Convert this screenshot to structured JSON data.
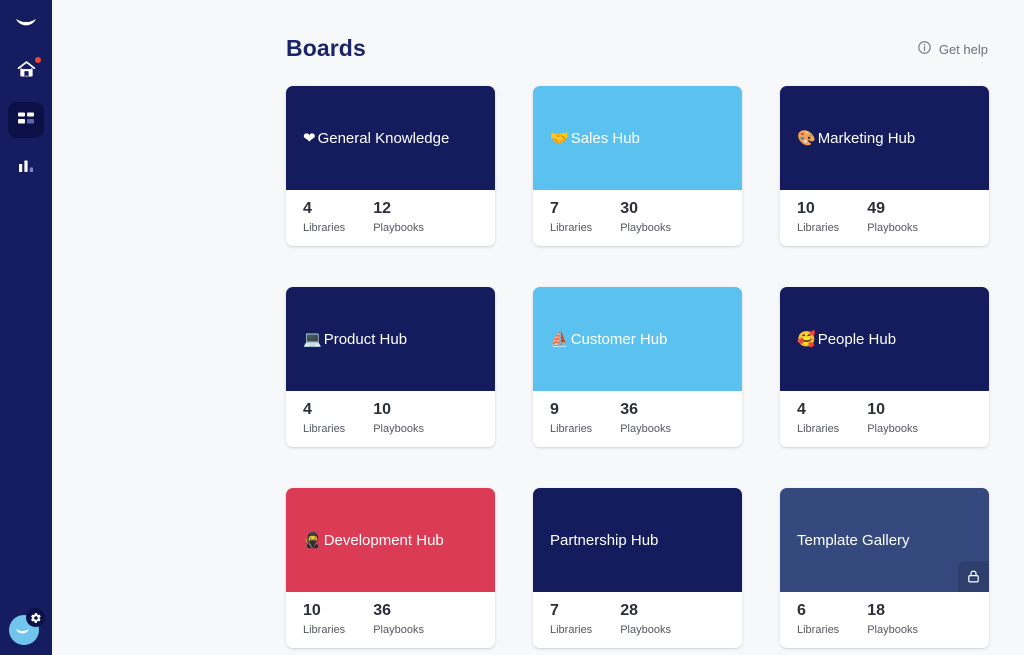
{
  "sidebar": {
    "logo": {
      "icon": "brand-logo-icon"
    },
    "items": [
      {
        "icon": "home-icon",
        "name": "home",
        "active": false,
        "badge": true
      },
      {
        "icon": "boards-grid-icon",
        "name": "boards",
        "active": true,
        "badge": false
      },
      {
        "icon": "analytics-bar-chart-icon",
        "name": "analytics",
        "active": false,
        "badge": false
      }
    ],
    "account": {
      "icon": "user-avatar-icon",
      "badge_icon": "gear-icon"
    },
    "colors": {
      "background": "#151C60",
      "active_item": "#0B1047",
      "badge_dot": "#F4452F",
      "avatar": "#71C5EC"
    }
  },
  "header": {
    "title": "Boards",
    "help": {
      "label": "Get help",
      "icon": "info-circle-icon"
    }
  },
  "stats_labels": {
    "libraries": "Libraries",
    "playbooks": "Playbooks"
  },
  "boards": [
    {
      "name": "General Knowledge",
      "emoji": "❤",
      "emoji_name": "heart-emoji",
      "libraries": "4",
      "playbooks": "12",
      "color": "#141C5E",
      "locked": false
    },
    {
      "name": "Sales Hub",
      "emoji": "🤝",
      "emoji_name": "handshake-emoji",
      "libraries": "7",
      "playbooks": "30",
      "color": "#5BC2F0",
      "locked": false
    },
    {
      "name": "Marketing Hub",
      "emoji": "🎨",
      "emoji_name": "artist-palette-emoji",
      "libraries": "10",
      "playbooks": "49",
      "color": "#141C5E",
      "locked": false
    },
    {
      "name": "Product Hub",
      "emoji": "💻",
      "emoji_name": "laptop-emoji",
      "libraries": "4",
      "playbooks": "10",
      "color": "#141C5E",
      "locked": false
    },
    {
      "name": "Customer Hub",
      "emoji": "⛵",
      "emoji_name": "sailboat-emoji",
      "libraries": "9",
      "playbooks": "36",
      "color": "#5BC2F0",
      "locked": false
    },
    {
      "name": "People Hub",
      "emoji": "🥰",
      "emoji_name": "smiling-face-with-hearts-emoji",
      "libraries": "4",
      "playbooks": "10",
      "color": "#141C5E",
      "locked": false
    },
    {
      "name": "Development Hub",
      "emoji": "🥷",
      "emoji_name": "ninja-emoji",
      "libraries": "10",
      "playbooks": "36",
      "color": "#DB3B55",
      "locked": false
    },
    {
      "name": "Partnership Hub",
      "emoji": "",
      "emoji_name": "",
      "libraries": "7",
      "playbooks": "28",
      "color": "#141C5E",
      "locked": false
    },
    {
      "name": "Template Gallery",
      "emoji": "",
      "emoji_name": "",
      "libraries": "6",
      "playbooks": "18",
      "color": "#36497E",
      "locked": true,
      "lock_icon": "lock-icon"
    }
  ]
}
